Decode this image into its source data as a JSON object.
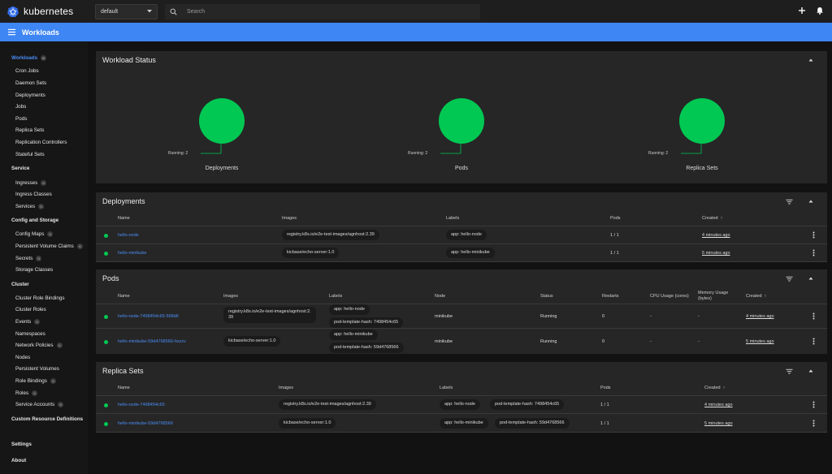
{
  "app": {
    "name": "kubernetes",
    "namespace": "default",
    "search_placeholder": "Search"
  },
  "page": {
    "title": "Workloads"
  },
  "sidebar": {
    "items": [
      {
        "label": "Workloads",
        "badge": "N",
        "header": true,
        "active": true
      },
      {
        "label": "Cron Jobs"
      },
      {
        "label": "Daemon Sets"
      },
      {
        "label": "Deployments"
      },
      {
        "label": "Jobs"
      },
      {
        "label": "Pods"
      },
      {
        "label": "Replica Sets"
      },
      {
        "label": "Replication Controllers"
      },
      {
        "label": "Stateful Sets"
      },
      {
        "label": "Service",
        "header": true
      },
      {
        "label": "Ingresses",
        "badge": "N"
      },
      {
        "label": "Ingress Classes"
      },
      {
        "label": "Services",
        "badge": "N"
      },
      {
        "label": "Config and Storage",
        "header": true
      },
      {
        "label": "Config Maps",
        "badge": "N"
      },
      {
        "label": "Persistent Volume Claims",
        "badge": "N"
      },
      {
        "label": "Secrets",
        "badge": "N"
      },
      {
        "label": "Storage Classes"
      },
      {
        "label": "Cluster",
        "header": true
      },
      {
        "label": "Cluster Role Bindings"
      },
      {
        "label": "Cluster Roles"
      },
      {
        "label": "Events",
        "badge": "N"
      },
      {
        "label": "Namespaces"
      },
      {
        "label": "Network Policies",
        "badge": "N"
      },
      {
        "label": "Nodes"
      },
      {
        "label": "Persistent Volumes"
      },
      {
        "label": "Role Bindings",
        "badge": "N"
      },
      {
        "label": "Roles",
        "badge": "N"
      },
      {
        "label": "Service Accounts",
        "badge": "N"
      },
      {
        "label": "Custom Resource Definitions",
        "header": true
      },
      {
        "label": "Settings",
        "header": true
      },
      {
        "label": "About",
        "header": true
      }
    ]
  },
  "workload_status": {
    "title": "Workload Status",
    "charts": [
      {
        "label": "Deployments",
        "legend": "Running: 2",
        "running": 2
      },
      {
        "label": "Pods",
        "legend": "Running: 2",
        "running": 2
      },
      {
        "label": "Replica Sets",
        "legend": "Running: 2",
        "running": 2
      }
    ]
  },
  "deployments": {
    "title": "Deployments",
    "columns": [
      "Name",
      "Images",
      "Labels",
      "Pods",
      "Created"
    ],
    "rows": [
      {
        "name": "hello-node",
        "image": "registry.k8s.io/e2e-test-images/agnhost:2.39",
        "labels": [
          "app: hello-node"
        ],
        "pods": "1 / 1",
        "created": "4 minutes ago"
      },
      {
        "name": "hello-minikube",
        "image": "kicbase/echo-server:1.0",
        "labels": [
          "app: hello-minikube"
        ],
        "pods": "1 / 1",
        "created": "5 minutes ago"
      }
    ]
  },
  "pods": {
    "title": "Pods",
    "columns": [
      "Name",
      "Images",
      "Labels",
      "Node",
      "Status",
      "Restarts",
      "CPU Usage (cores)",
      "Memory Usage",
      "(bytes)",
      "Created"
    ],
    "rows": [
      {
        "name": "hello-node-7498454c65-568d6",
        "image_l1": "registry.k8s.io/e2e-test-images/agnhost:2.",
        "image_l2": "39",
        "labels": [
          "app: hello-node",
          "pod-template-hash: 7498454c65"
        ],
        "node": "minikube",
        "status": "Running",
        "restarts": "0",
        "cpu": "-",
        "memory": "-",
        "created": "4 minutes ago"
      },
      {
        "name": "hello-minikube-59d4768566-hxzzv",
        "image_l1": "kicbase/echo-server:1.0",
        "image_l2": "",
        "labels": [
          "app: hello-minikube",
          "pod-template-hash: 59d4768566"
        ],
        "node": "minikube",
        "status": "Running",
        "restarts": "0",
        "cpu": "-",
        "memory": "-",
        "created": "5 minutes ago"
      }
    ]
  },
  "replica_sets": {
    "title": "Replica Sets",
    "columns": [
      "Name",
      "Images",
      "Labels",
      "Pods",
      "Created"
    ],
    "rows": [
      {
        "name": "hello-node-7498454c65",
        "image": "registry.k8s.io/e2e-test-images/agnhost:2.39",
        "labels": [
          "app: hello-node",
          "pod-template-hash: 7498454c65"
        ],
        "pods": "1 / 1",
        "created": "4 minutes ago"
      },
      {
        "name": "hello-minikube-59d4768566",
        "image": "kicbase/echo-server:1.0",
        "labels": [
          "app: hello-minikube",
          "pod-template-hash: 59d4768566"
        ],
        "pods": "1 / 1",
        "created": "5 minutes ago"
      }
    ]
  },
  "sort_arrow": "↑",
  "colors": {
    "accent": "#3e86f3",
    "running": "#00c853",
    "link": "#4a8df5"
  }
}
